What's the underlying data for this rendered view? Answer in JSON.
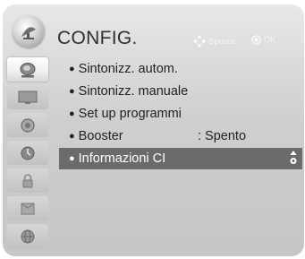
{
  "header": {
    "title": "CONFIG.",
    "hint_move": "Sposta",
    "hint_ok": "OK"
  },
  "sidebar": {
    "items": [
      {
        "icon": "antenna-dish-icon",
        "active": true
      },
      {
        "icon": "picture-screen-icon",
        "active": false
      },
      {
        "icon": "speaker-audio-icon",
        "active": false
      },
      {
        "icon": "clock-time-icon",
        "active": false
      },
      {
        "icon": "lock-icon",
        "active": false
      },
      {
        "icon": "option-box-icon",
        "active": false
      },
      {
        "icon": "network-globe-icon",
        "active": false
      }
    ]
  },
  "menu": {
    "items": [
      {
        "label": "Sintonizz. autom.",
        "value": ""
      },
      {
        "label": "Sintonizz. manuale",
        "value": ""
      },
      {
        "label": "Set up programmi",
        "value": ""
      },
      {
        "label": "Booster",
        "value": ": Spento"
      },
      {
        "label": "Informazioni CI",
        "value": "",
        "selected": true
      }
    ]
  },
  "colors": {
    "selected_row": "#6b6b6b",
    "panel_background": "#cfcfcf"
  }
}
